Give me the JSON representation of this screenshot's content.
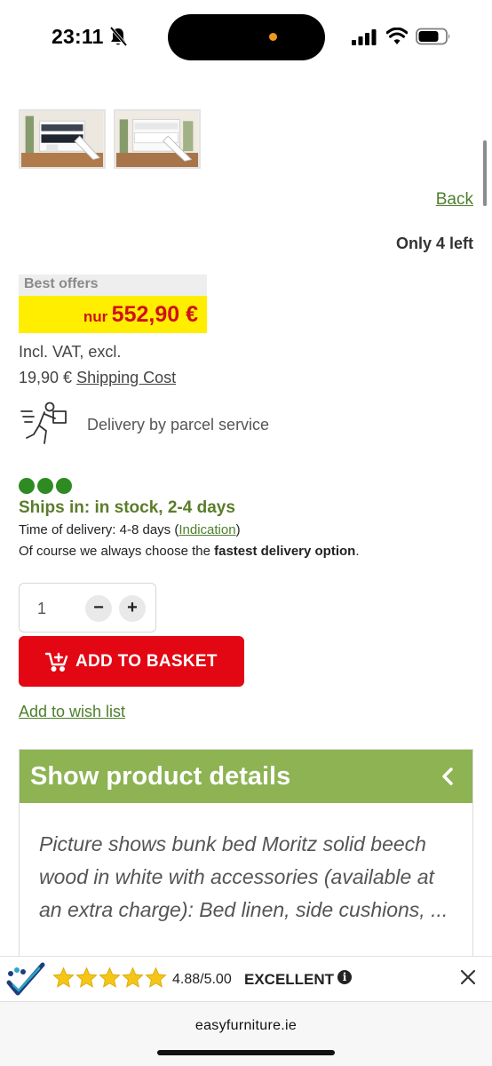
{
  "status_bar": {
    "time": "23:11"
  },
  "gallery": {
    "thumbnails": [
      "bunk-bed-photo-1",
      "bunk-bed-photo-2"
    ]
  },
  "nav": {
    "back_label": "Back"
  },
  "stock": {
    "only_left": "Only 4 left"
  },
  "pricing": {
    "offers_label": "Best offers",
    "price_prefix": "nur",
    "price": "552,90 €",
    "vat_line1": "Incl. VAT, excl.",
    "shipping_amount": "19,90 €",
    "shipping_link": "Shipping Cost"
  },
  "delivery": {
    "service_text": "Delivery by parcel service",
    "availability_dots": 3,
    "ships_in": "Ships in: in stock, 2-4 days",
    "time_prefix": "Time of delivery: 4-8 days (",
    "indication_link": "Indication",
    "time_suffix": ")",
    "option_prefix": "Of course we always choose the ",
    "option_bold": "fastest delivery option",
    "option_suffix": "."
  },
  "cart": {
    "quantity": "1",
    "minus_label": "−",
    "plus_label": "+",
    "add_to_basket": "ADD TO BASKET",
    "wish_list": "Add to wish list"
  },
  "details": {
    "header": "Show product details",
    "description": "Picture shows bunk bed Moritz solid beech wood in white with accessories (available at an extra charge): Bed linen, side cushions, ..."
  },
  "rating": {
    "stars": 5,
    "score": "4.88/5.00",
    "label": "EXCELLENT",
    "info_symbol": "i"
  },
  "browser": {
    "url": "easyfurniture.ie"
  },
  "colors": {
    "accent_green": "#8db352",
    "link_green": "#4d7f2b",
    "basket_red": "#e30613",
    "price_red": "#d0101b",
    "price_yellow": "#ffee00",
    "star_yellow": "#f5c518"
  }
}
